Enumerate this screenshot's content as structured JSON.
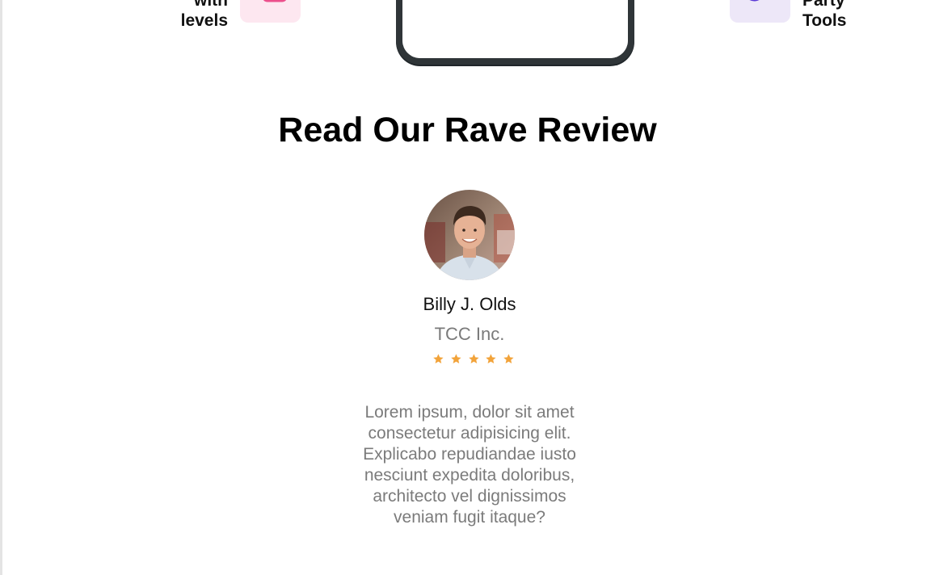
{
  "features": {
    "left": {
      "lines": [
        "with",
        "levels"
      ],
      "icon": "square-icon",
      "icon_color": "#ec4f8c",
      "tile_color": "#fde7f0"
    },
    "right": {
      "lines": [
        "Party",
        "Tools"
      ],
      "icon": "loading-arc-icon",
      "icon_color": "#5b3ad6",
      "tile_color": "#ede7f8"
    }
  },
  "phone": {
    "icon": "phone-mockup"
  },
  "review_section": {
    "title": "Read Our Rave Review",
    "reviewer": {
      "name": "Billy J. Olds",
      "company": "TCC Inc.",
      "avatar": "avatar-photo",
      "rating": 5,
      "star_color": "#f2a33a"
    },
    "text": "Lorem ipsum, dolor sit amet consectetur adipisicing elit. Explicabo repudiandae iusto nesciunt expedita doloribus, architecto vel dignissimos veniam fugit itaque?"
  }
}
